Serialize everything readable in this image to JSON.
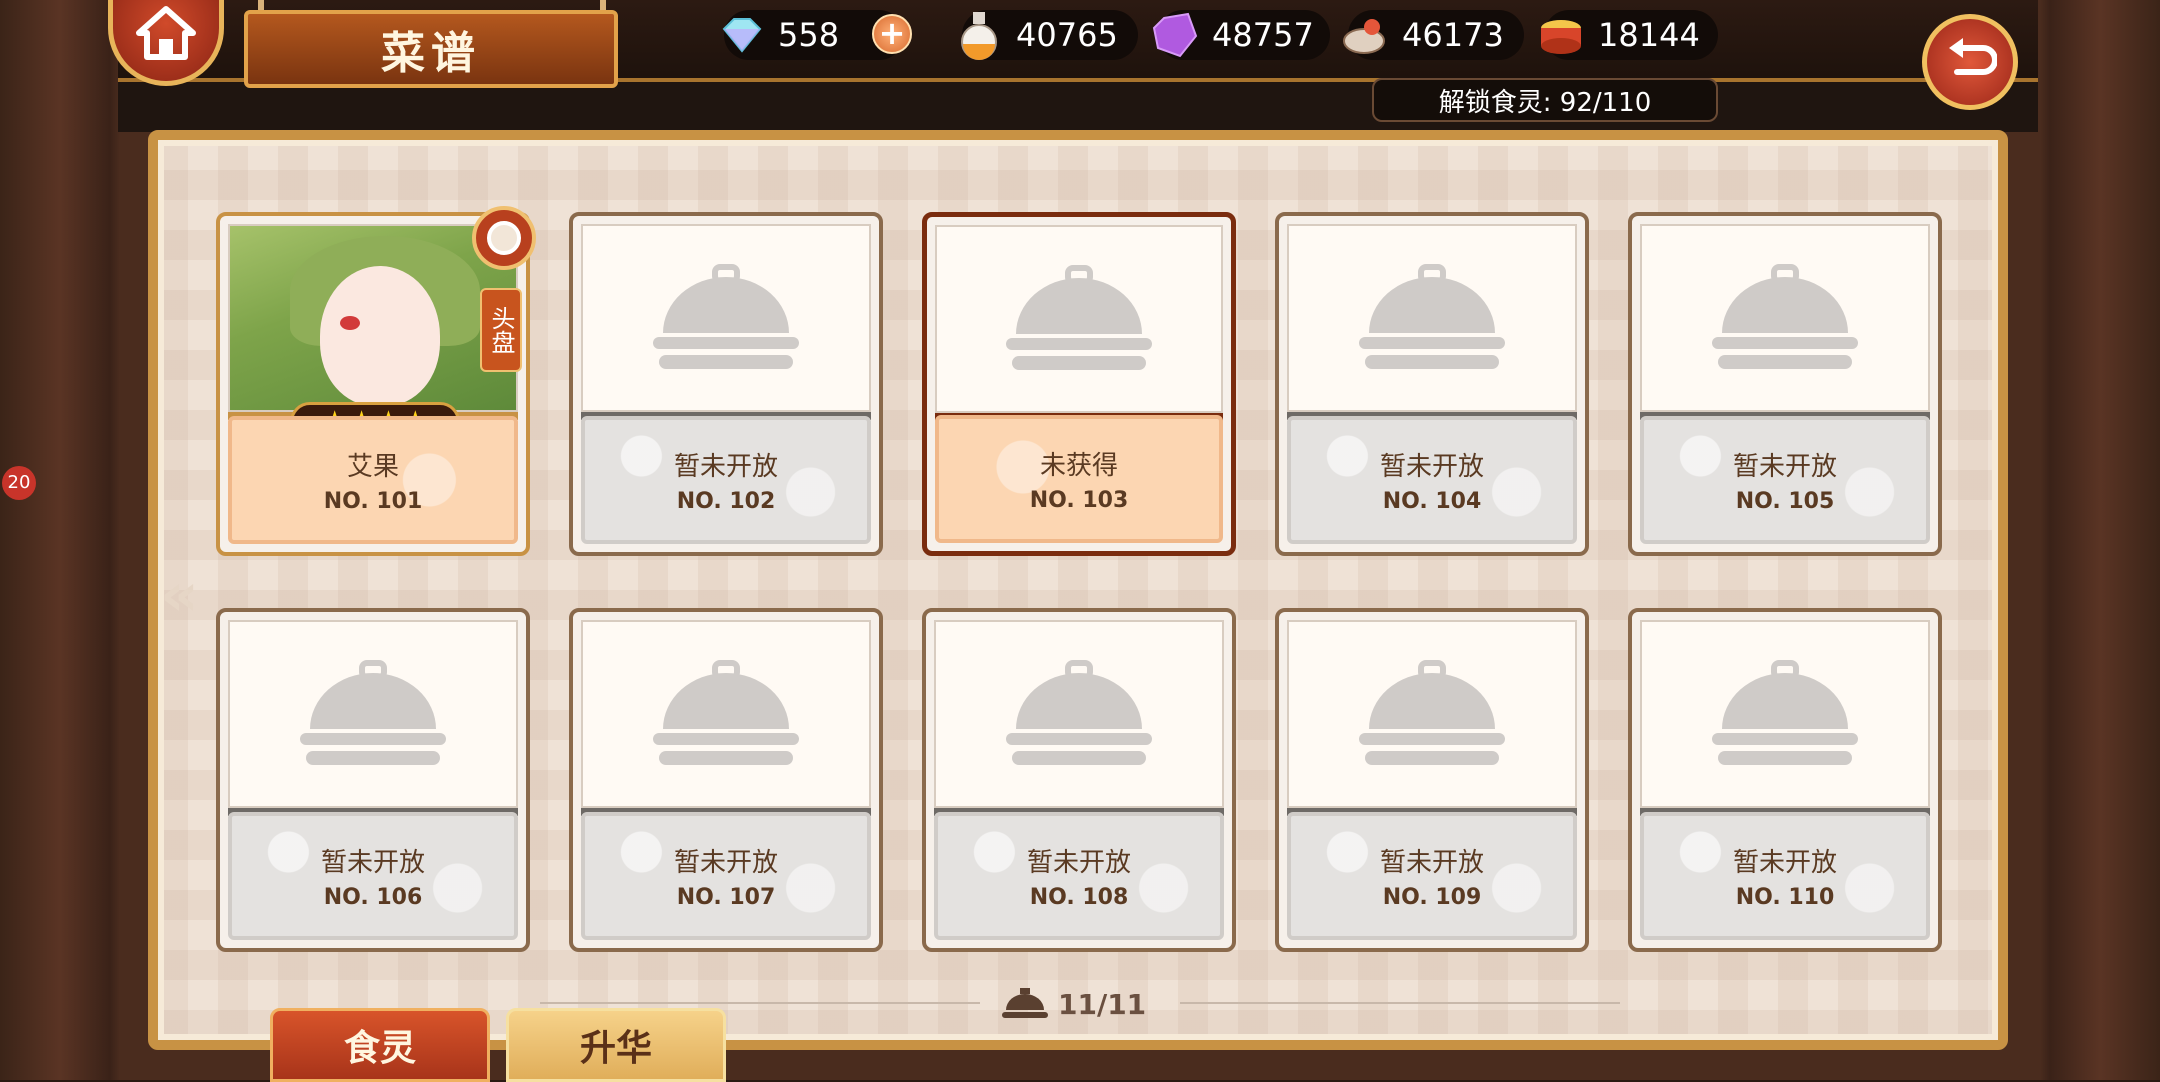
{
  "header": {
    "title": "菜谱",
    "unlock_text": "解锁食灵: 92/110"
  },
  "resources": [
    {
      "icon": "diamond-icon",
      "value": "558"
    },
    {
      "icon": "potion-icon",
      "value": "40765"
    },
    {
      "icon": "crystal-icon",
      "value": "48757"
    },
    {
      "icon": "meat-icon",
      "value": "46173"
    },
    {
      "icon": "drum-icon",
      "value": "18144"
    }
  ],
  "side_badge": "20",
  "cards": [
    {
      "name": "艾果",
      "no": "NO. 101",
      "state": "owned",
      "role": "头盘",
      "stars": "★★★★"
    },
    {
      "name": "暂未开放",
      "no": "NO. 102",
      "state": "locked"
    },
    {
      "name": "未获得",
      "no": "NO. 103",
      "state": "highlight"
    },
    {
      "name": "暂未开放",
      "no": "NO. 104",
      "state": "locked"
    },
    {
      "name": "暂未开放",
      "no": "NO. 105",
      "state": "locked"
    },
    {
      "name": "暂未开放",
      "no": "NO. 106",
      "state": "locked"
    },
    {
      "name": "暂未开放",
      "no": "NO. 107",
      "state": "locked"
    },
    {
      "name": "暂未开放",
      "no": "NO. 108",
      "state": "locked"
    },
    {
      "name": "暂未开放",
      "no": "NO. 109",
      "state": "locked"
    },
    {
      "name": "暂未开放",
      "no": "NO. 110",
      "state": "locked"
    }
  ],
  "pagination": "11/11",
  "tabs": [
    {
      "label": "食灵"
    },
    {
      "label": "升华"
    }
  ],
  "colors": {
    "accent_gold": "#c89244",
    "tab_active": "#c8441e",
    "highlight_card": "#7a2c0e"
  }
}
